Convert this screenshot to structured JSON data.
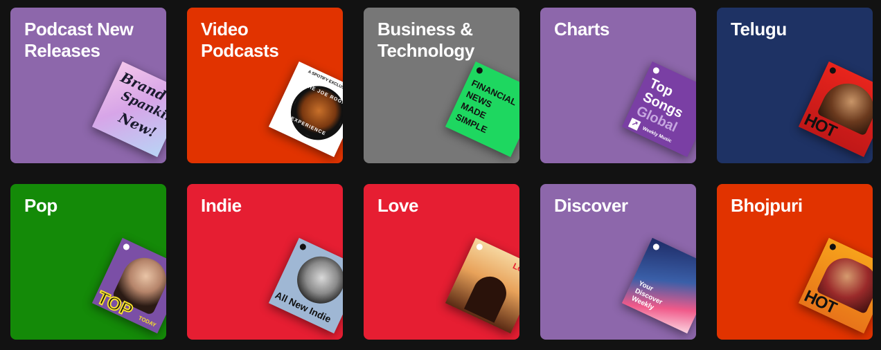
{
  "cards": [
    {
      "title": "Podcast New Releases",
      "bg": "#8d67ab",
      "art_text": [
        "Brand",
        "Spankin'",
        "New!"
      ]
    },
    {
      "title": "Video Podcasts",
      "bg": "#e13300",
      "art_text": [
        "THE JOE ROGAN",
        "EXPERIENCE",
        "A SPOTIFY EXCLUSIVE"
      ]
    },
    {
      "title": "Business & Technology",
      "bg": "#777777",
      "art_text": [
        "FINANCIAL",
        "NEWS",
        "MADE",
        "SIMPLE"
      ]
    },
    {
      "title": "Charts",
      "bg": "#8d67ab",
      "art_text": [
        "Top",
        "Songs",
        "Global",
        "Weekly Music"
      ]
    },
    {
      "title": "Telugu",
      "bg": "#1e3264",
      "art_text": [
        "HOT HITS"
      ]
    },
    {
      "title": "Pop",
      "bg": "#148a08",
      "art_text": [
        "TOP",
        "TODAY"
      ]
    },
    {
      "title": "Indie",
      "bg": "#e61e32",
      "art_text": [
        "All New Indie"
      ]
    },
    {
      "title": "Love",
      "bg": "#e61e32",
      "art_text": [
        "Love"
      ]
    },
    {
      "title": "Discover",
      "bg": "#8d67ab",
      "art_text": [
        "Your",
        "Discover",
        "Weekly"
      ]
    },
    {
      "title": "Bhojpuri",
      "bg": "#e13300",
      "art_text": [
        "HOT HITS"
      ]
    }
  ]
}
